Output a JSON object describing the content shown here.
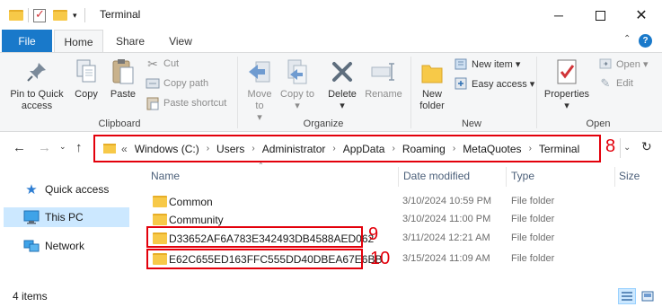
{
  "window": {
    "title": "Terminal"
  },
  "ribbon_tabs": [
    "File",
    "Home",
    "Share",
    "View"
  ],
  "ribbon": {
    "clipboard": {
      "label": "Clipboard",
      "pin_to_quick_access": "Pin to Quick access",
      "copy": "Copy",
      "paste": "Paste",
      "cut": "Cut",
      "copy_path": "Copy path",
      "paste_shortcut": "Paste shortcut"
    },
    "organize": {
      "label": "Organize",
      "move_to": "Move to",
      "copy_to": "Copy to",
      "delete": "Delete",
      "rename": "Rename"
    },
    "new": {
      "label": "New",
      "new_folder": "New folder",
      "new_item": "New item",
      "easy_access": "Easy access"
    },
    "open": {
      "label": "Open",
      "properties": "Properties",
      "open": "Open",
      "edit": "Edit"
    }
  },
  "address": {
    "overflow": "«",
    "crumbs": [
      "Windows (C:)",
      "Users",
      "Administrator",
      "AppData",
      "Roaming",
      "MetaQuotes",
      "Terminal"
    ],
    "callout": "8"
  },
  "navpane": {
    "items": [
      "Quick access",
      "This PC",
      "Network"
    ]
  },
  "columns": {
    "name": "Name",
    "date": "Date modified",
    "type": "Type",
    "size": "Size"
  },
  "files": [
    {
      "name": "Common",
      "date": "3/10/2024 10:59 PM",
      "type": "File folder"
    },
    {
      "name": "Community",
      "date": "3/10/2024 11:00 PM",
      "type": "File folder"
    },
    {
      "name": "D33652AF6A783E342493DB4588AED062",
      "date": "3/11/2024 12:21 AM",
      "type": "File folder",
      "callout": "9"
    },
    {
      "name": "E62C655ED163FFC555DD40DBEA67E6BB",
      "date": "3/15/2024 11:09 AM",
      "type": "File folder",
      "callout": "10"
    }
  ],
  "status": {
    "item_count": "4 items"
  },
  "colors": {
    "accent": "#1979ca",
    "highlight": "#e3000b",
    "selection": "#cce8ff",
    "folder": "#f7c948"
  }
}
